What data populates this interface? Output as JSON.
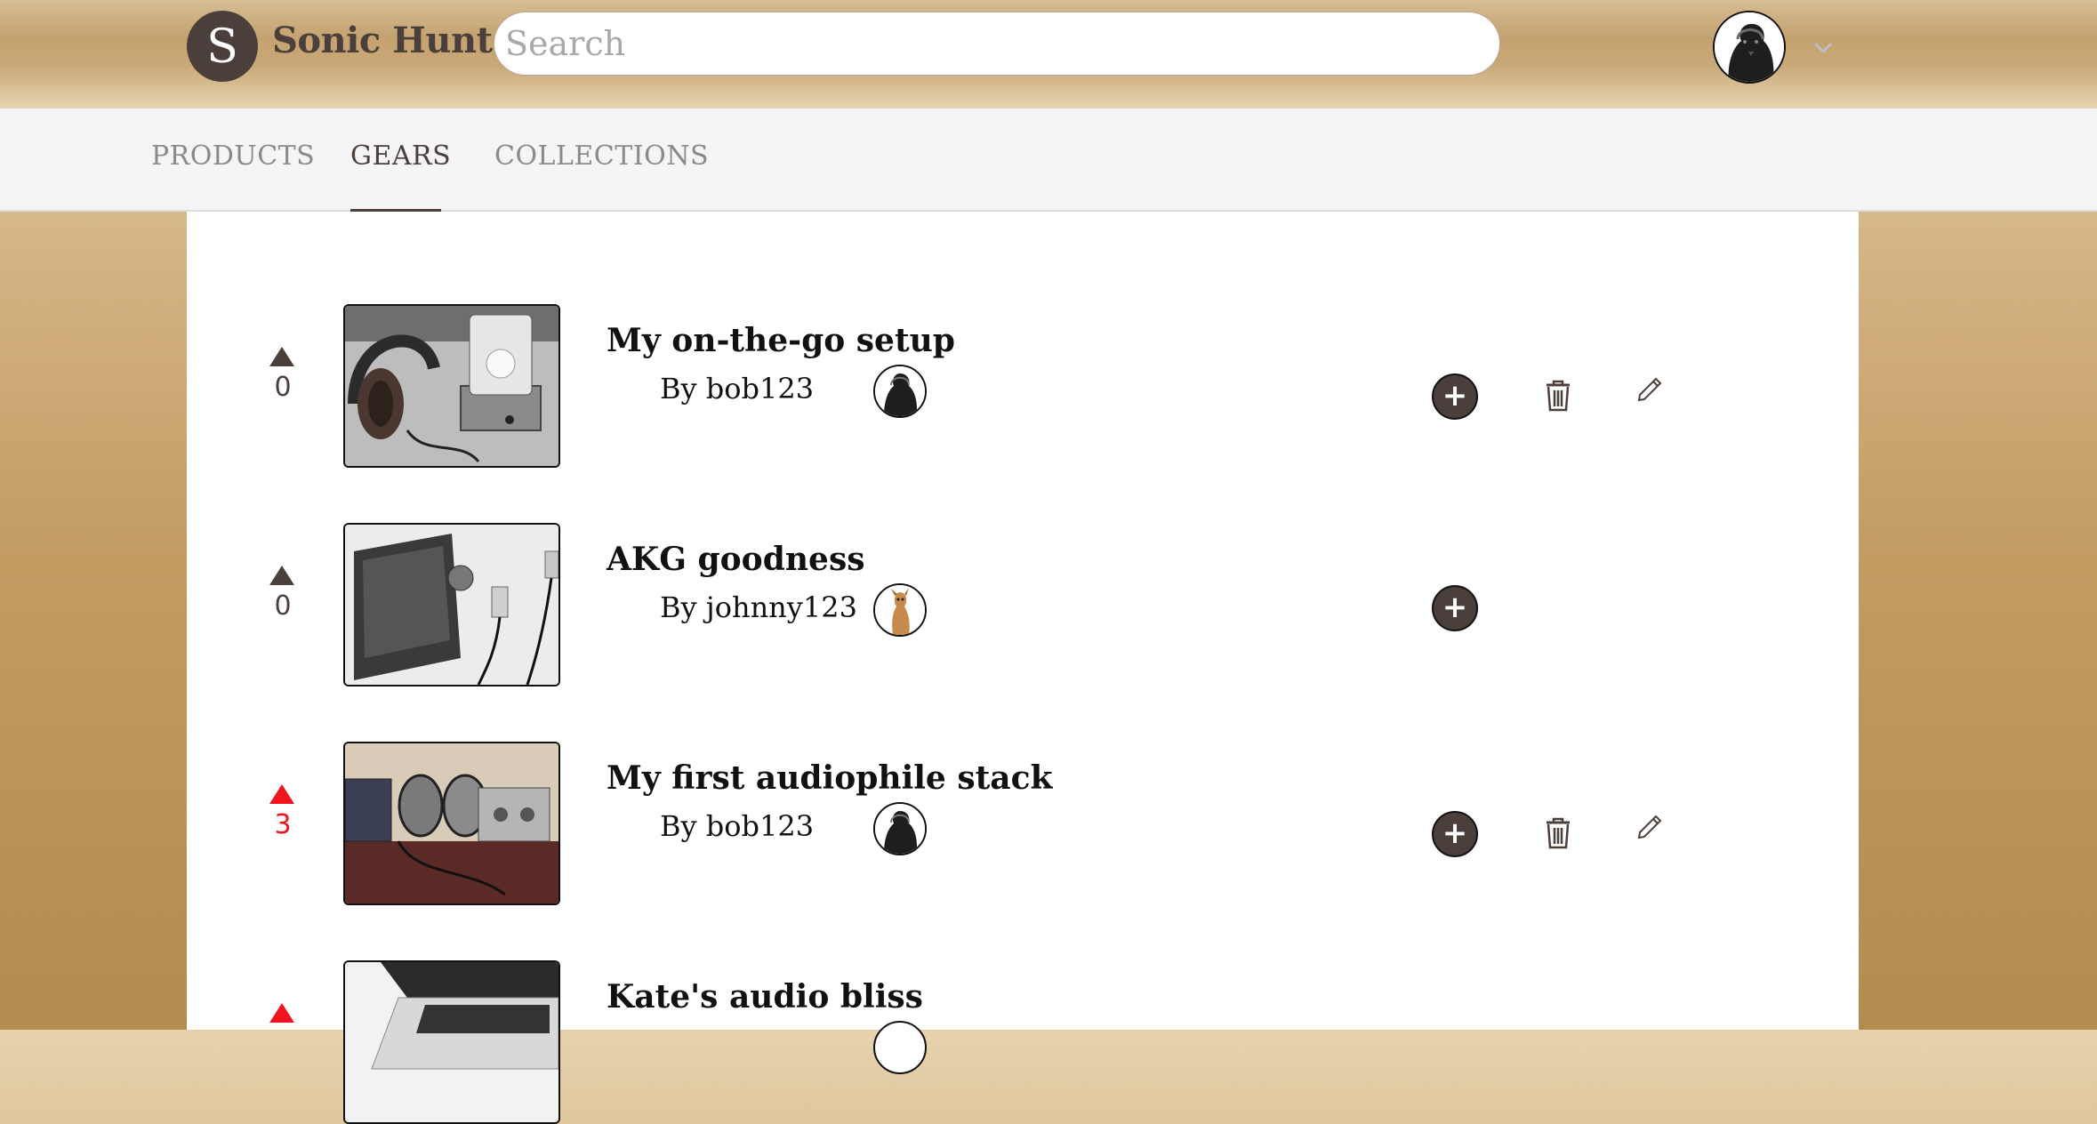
{
  "header": {
    "logo_letter": "S",
    "brand": "Sonic Hunt",
    "search_placeholder": "Search",
    "user_menu_icon": "chevron-down-icon"
  },
  "tabs": [
    {
      "label": "PRODUCTS",
      "active": false
    },
    {
      "label": "GEARS",
      "active": true
    },
    {
      "label": "COLLECTIONS",
      "active": false
    }
  ],
  "gears": [
    {
      "votes": "0",
      "title": "My on-the-go setup",
      "byline": "By bob123",
      "avatar": "dog-avatar",
      "can_edit": true,
      "upvoted": false
    },
    {
      "votes": "0",
      "title": "AKG goodness",
      "byline": "By johnny123",
      "avatar": "fawn-dog-avatar",
      "can_edit": false,
      "upvoted": false
    },
    {
      "votes": "3",
      "title": "My first audiophile stack",
      "byline": "By bob123",
      "avatar": "dog-avatar",
      "can_edit": true,
      "upvoted": true
    },
    {
      "title": "Kate's audio bliss",
      "upvoted": true
    }
  ],
  "actions": {
    "add_label": "+",
    "add_icon": "plus-icon",
    "delete_icon": "trash-icon",
    "edit_icon": "pencil-icon"
  },
  "colors": {
    "brand_dark": "#4b3f3b",
    "upvote_active": "#f0141e",
    "header_gold": "#c4a270"
  }
}
